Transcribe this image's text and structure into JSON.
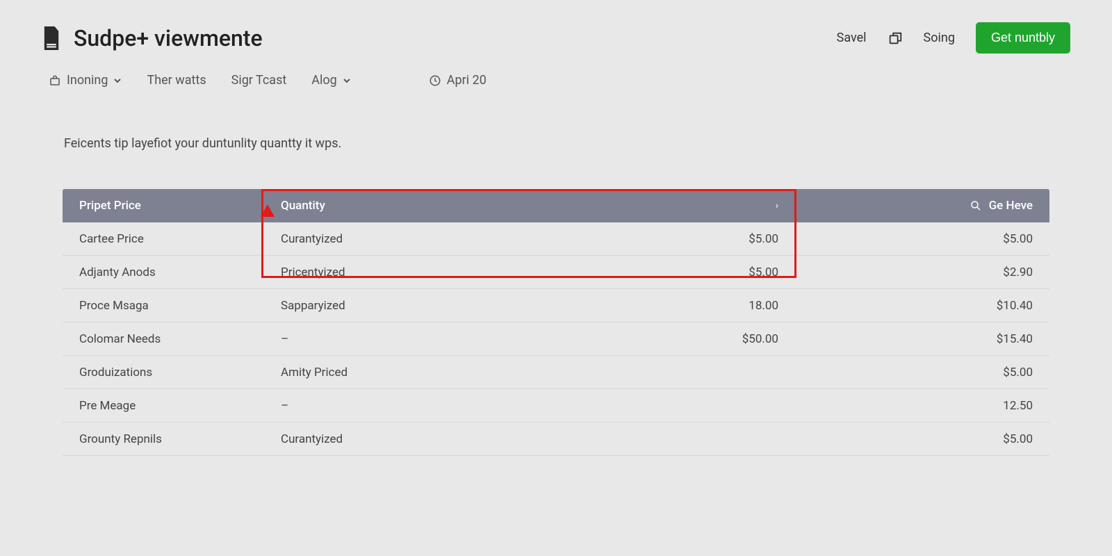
{
  "header": {
    "title": "Sudpe+ viewmente",
    "save_label": "Savel",
    "soing_label": "Soing",
    "primary_button": "Get nuntbly"
  },
  "toolbar": {
    "inoning": "Inoning",
    "ther_watts": "Ther watts",
    "sigr_tcast": "Sigr Tcast",
    "alog": "Alog",
    "date": "Apri 20"
  },
  "summary_text": "Feicents tip layefiot your duntunlity quantty it wps.",
  "table": {
    "headers": {
      "col1": "Pripet Price",
      "col2": "Quantity",
      "col3": "Ge Heve"
    },
    "rows": [
      {
        "name": "Cartee Price",
        "qty": "Curantyized",
        "amt1": "$5.00",
        "amt2": "$5.00"
      },
      {
        "name": "Adjanty Anods",
        "qty": "Pricentyized",
        "amt1": "$5.00",
        "amt2": "$2.90"
      },
      {
        "name": "Proce Msaga",
        "qty": "Sapparyized",
        "amt1": "18.00",
        "amt2": "$10.40"
      },
      {
        "name": "Colomar Needs",
        "qty": "–",
        "amt1": "$50.00",
        "amt2": "$15.40"
      },
      {
        "name": "Groduizations",
        "qty": "Amity Priced",
        "amt1": "",
        "amt2": "$5.00"
      },
      {
        "name": "Pre Meage",
        "qty": "–",
        "amt1": "",
        "amt2": "12.50"
      },
      {
        "name": "Grounty Repnils",
        "qty": "Curantyized",
        "amt1": "",
        "amt2": "$5.00"
      }
    ]
  }
}
